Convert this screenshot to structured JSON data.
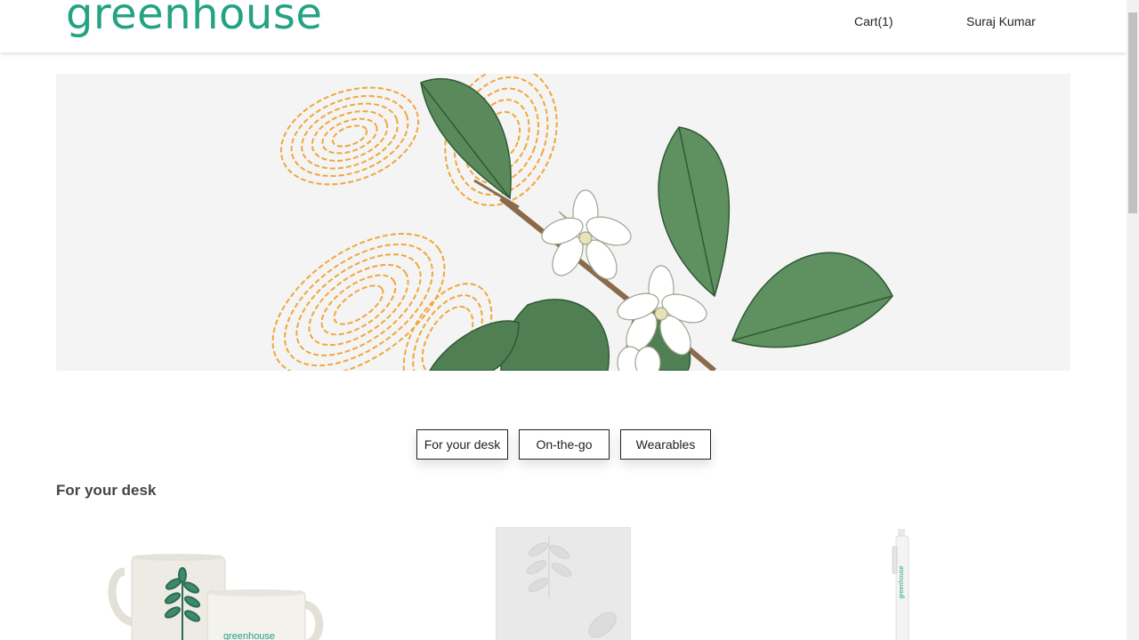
{
  "header": {
    "logo": "greenhouse",
    "cart_label": "Cart(1)",
    "user_name": "Suraj Kumar"
  },
  "tabs": [
    {
      "label": "For your desk"
    },
    {
      "label": "On-the-go"
    },
    {
      "label": "Wearables"
    }
  ],
  "section": {
    "title": "For your desk"
  },
  "products": [
    {
      "name": "mugs",
      "brand_text": "greenhouse"
    },
    {
      "name": "notebook"
    },
    {
      "name": "pen",
      "brand_text": "greenhouse"
    }
  ],
  "colors": {
    "brand": "#23a383",
    "leaf_green": "#4f7f52",
    "fingerprint_orange": "#f0a73b",
    "hero_bg": "#f4f4f4"
  }
}
